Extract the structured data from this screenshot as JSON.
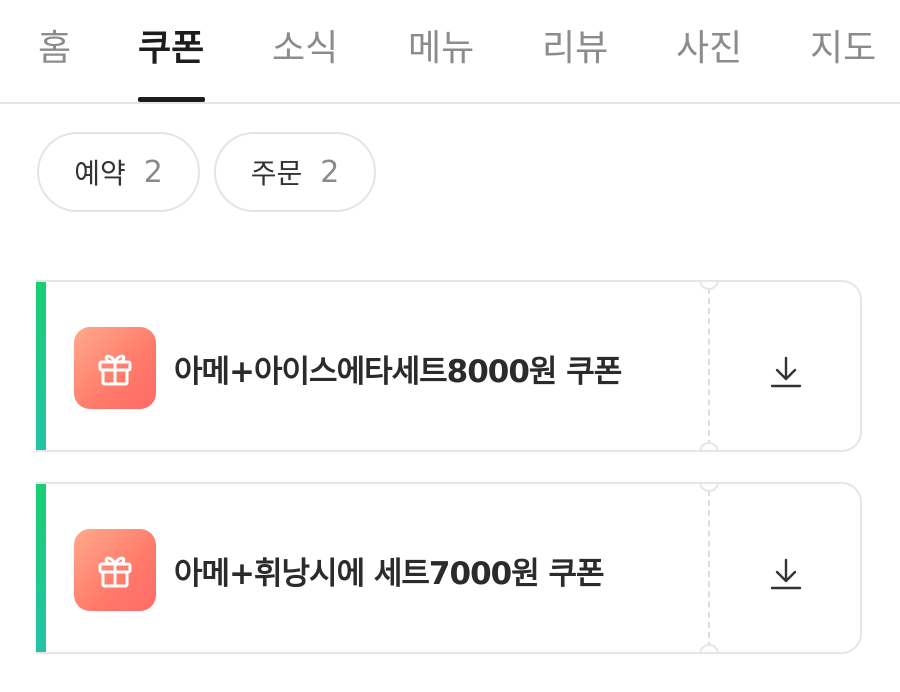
{
  "tabs": [
    {
      "label": "홈"
    },
    {
      "label": "쿠폰",
      "active": true
    },
    {
      "label": "소식"
    },
    {
      "label": "메뉴"
    },
    {
      "label": "리뷰"
    },
    {
      "label": "사진"
    },
    {
      "label": "지도"
    }
  ],
  "filters": [
    {
      "label": "예약",
      "count": "2"
    },
    {
      "label": "주문",
      "count": "2"
    }
  ],
  "coupons": [
    {
      "title": "아메+아이스에타세트8000원 쿠폰",
      "icon": "gift-icon",
      "action_icon": "download-icon"
    },
    {
      "title": "아메+휘낭시에 세트7000원 쿠폰",
      "icon": "gift-icon",
      "action_icon": "download-icon"
    }
  ],
  "colors": {
    "accent_bar": "#19cf71",
    "gift_bg": "#ff7a6a",
    "active_tab": "#1d1d1d",
    "inactive_tab": "#8c8c8c"
  }
}
